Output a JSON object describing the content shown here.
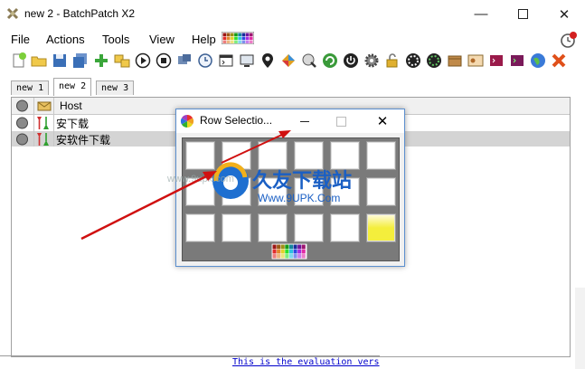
{
  "window": {
    "title": "new 2 - BatchPatch X2"
  },
  "menubar": {
    "items": [
      "File",
      "Actions",
      "Tools",
      "View",
      "Help"
    ]
  },
  "toolbar": {
    "icons": [
      "new-icon",
      "open-icon",
      "save-icon",
      "save-all-icon",
      "add-host-icon",
      "copy-icon",
      "play-icon",
      "stop-icon",
      "deploy-icon",
      "schedule-icon",
      "cmd-icon",
      "computer-icon",
      "location-icon",
      "diamond-icon",
      "settings-icon",
      "refresh-icon",
      "power-icon",
      "gear-icon",
      "unlock-icon",
      "spin-icon",
      "spin2-icon",
      "package-icon",
      "id-card-icon",
      "terminal-icon",
      "terminal2-icon",
      "globe-icon",
      "cancel-icon"
    ]
  },
  "tabs": [
    {
      "label": "new 1"
    },
    {
      "label": "new 2",
      "active": true
    },
    {
      "label": "new 3"
    }
  ],
  "grid": {
    "host_header": "Host",
    "rows": [
      {
        "host": "安下载"
      },
      {
        "host": "安软件下载"
      }
    ]
  },
  "dialog": {
    "title": "Row Selectio..."
  },
  "watermark": {
    "brand": "久友下载站",
    "url": "Www.9UPK.Com",
    "faint": "www.9upk.com"
  },
  "status": {
    "link_text": "This is the evaluation vers"
  },
  "colors": {
    "selected_row": "#d4d4d4",
    "dialog_border": "#5b8fcf",
    "yellow_swatch": "#f4ee3c",
    "link": "#0000cc",
    "arrow": "#d01010"
  }
}
